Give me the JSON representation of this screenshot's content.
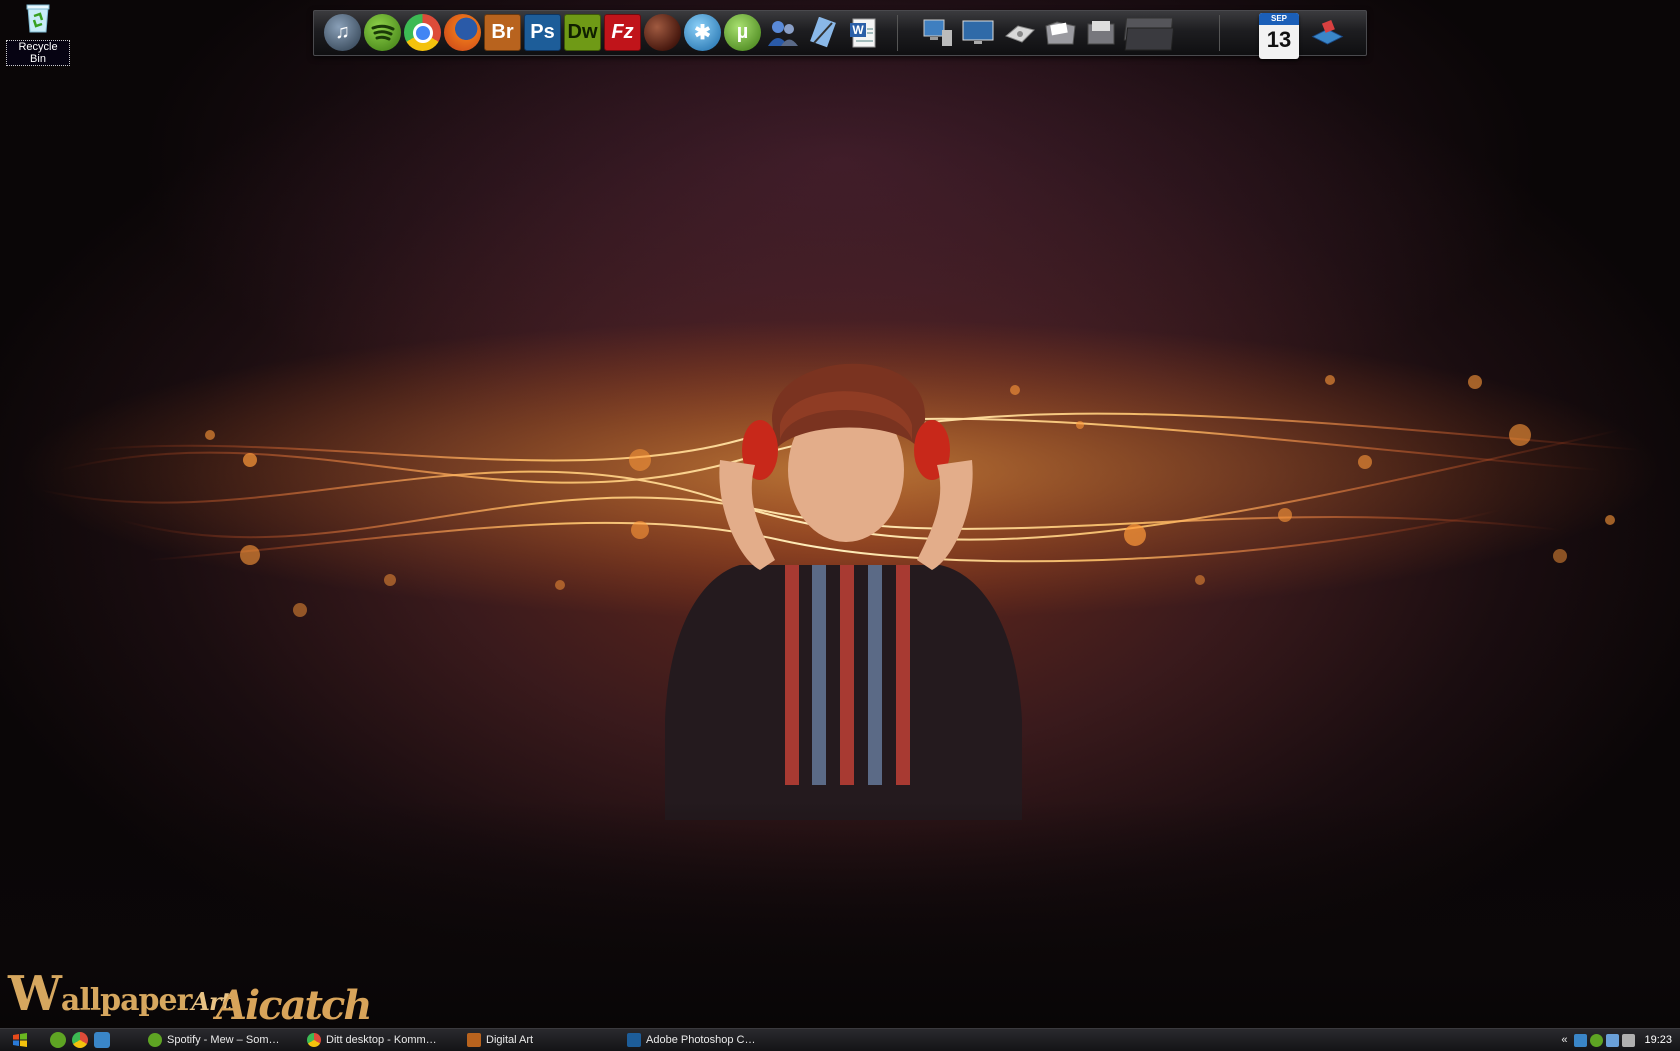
{
  "desktop": {
    "icons": [
      {
        "label": "Recycle Bin",
        "icon": "recycle-bin-icon"
      }
    ]
  },
  "dock": {
    "apps": [
      {
        "name": "iTunes",
        "icon": "itunes-icon",
        "glyph": "♫",
        "color": "#3a4a5a"
      },
      {
        "name": "Spotify",
        "icon": "spotify-icon",
        "glyph": "",
        "color": "#5ea423"
      },
      {
        "name": "Google Chrome",
        "icon": "chrome-icon",
        "glyph": "",
        "color": "#dd4b39"
      },
      {
        "name": "Firefox",
        "icon": "firefox-icon",
        "glyph": "",
        "color": "#e8701a"
      },
      {
        "name": "Adobe Bridge",
        "icon": "bridge-icon",
        "glyph": "Br",
        "color": "#b8631e"
      },
      {
        "name": "Adobe Photoshop",
        "icon": "photoshop-icon",
        "glyph": "Ps",
        "color": "#1d5d99"
      },
      {
        "name": "Adobe Dreamweaver",
        "icon": "dreamweaver-icon",
        "glyph": "Dw",
        "color": "#6f9a16"
      },
      {
        "name": "FileZilla",
        "icon": "filezilla-icon",
        "glyph": "Fz",
        "color": "#c0141a"
      },
      {
        "name": "Planet",
        "icon": "planet-icon",
        "glyph": "",
        "color": "#6a3a2a"
      },
      {
        "name": "Network Tool",
        "icon": "network-icon",
        "glyph": "✱",
        "color": "#3a9ad6"
      },
      {
        "name": "uTorrent",
        "icon": "utorrent-icon",
        "glyph": "µ",
        "color": "#6bb034"
      },
      {
        "name": "Messenger",
        "icon": "messenger-icon",
        "glyph": "",
        "color": "#2a6aa8"
      },
      {
        "name": "Notepad",
        "icon": "notepad-icon",
        "glyph": "",
        "color": "#4a7ab8"
      },
      {
        "name": "Microsoft Word",
        "icon": "word-icon",
        "glyph": "W",
        "color": "#2b5fa8"
      }
    ],
    "system": [
      {
        "name": "My Computer",
        "icon": "computer-icon",
        "color": "#3f7fc0"
      },
      {
        "name": "Monitor",
        "icon": "monitor-icon",
        "color": "#2f6aa8"
      },
      {
        "name": "Drive",
        "icon": "drive-icon",
        "color": "#c8c8c8"
      },
      {
        "name": "Folder",
        "icon": "folder-icon",
        "color": "#8a8a8e"
      },
      {
        "name": "Documents",
        "icon": "documents-icon",
        "color": "#7a7a80"
      },
      {
        "name": "Stack",
        "icon": "stack-icon",
        "color": "#55555a"
      }
    ],
    "widgets": {
      "calendar": {
        "month": "SEP",
        "day": "13"
      },
      "recycle": {
        "name": "Recycle",
        "icon": "recycle-dock-icon",
        "color": "#3a86c8"
      }
    }
  },
  "branding": {
    "wallpaper_w": "W",
    "wallpaper_rest": "allpaper",
    "wallpaper_art": "Art",
    "aicatch": "Aicatch"
  },
  "taskbar": {
    "quick_launch": [
      {
        "icon": "spotify-quicklaunch-icon",
        "color": "#5ea423"
      },
      {
        "icon": "chrome-quicklaunch-icon",
        "color": "#dd4b39"
      },
      {
        "icon": "ie-quicklaunch-icon",
        "color": "#3a86c8"
      }
    ],
    "tasks": [
      {
        "label": "Spotify - Mew – Som…",
        "icon": "spotify-task-icon",
        "color": "#5ea423"
      },
      {
        "label": "Ditt desktop - Komm…",
        "icon": "chrome-task-icon",
        "color": "#dd4b39"
      },
      {
        "label": "Digital Art",
        "icon": "bridge-task-icon",
        "color": "#b8631e"
      },
      {
        "label": "Adobe Photoshop C…",
        "icon": "photoshop-task-icon",
        "color": "#1d5d99"
      }
    ],
    "tray": {
      "expand": "«",
      "icons": [
        {
          "icon": "network-tray-icon",
          "color": "#3a86c8"
        },
        {
          "icon": "spotify-tray-icon",
          "color": "#5ea423"
        },
        {
          "icon": "connection-tray-icon",
          "color": "#6aa0d8"
        },
        {
          "icon": "sound-tray-icon",
          "color": "#b0b0b0"
        }
      ],
      "clock": "19:23"
    }
  },
  "colors": {
    "accent": "#d6a75f",
    "glow": "#ff8a2a"
  }
}
